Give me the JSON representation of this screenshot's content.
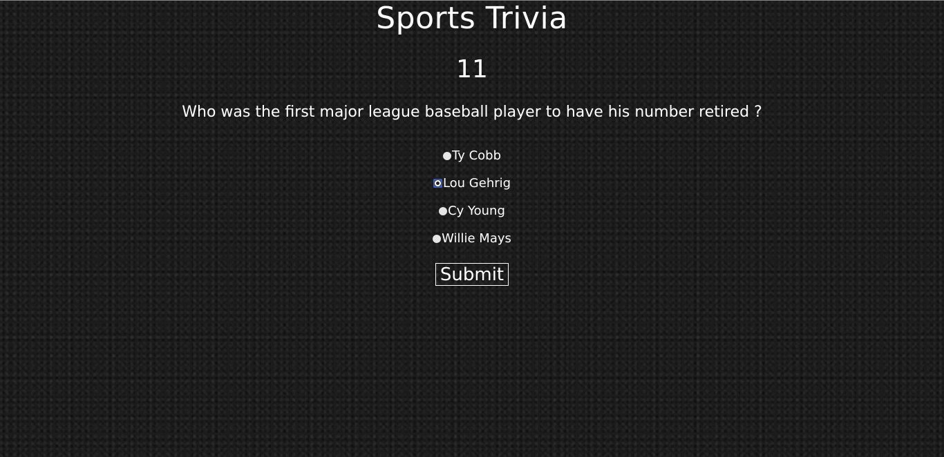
{
  "app": {
    "title": "Sports Trivia"
  },
  "quiz": {
    "question_number": "11",
    "question_text": "Who was the first major league baseball player to have his number retired ?",
    "options": [
      {
        "label": "Ty Cobb",
        "selected": false
      },
      {
        "label": "Lou Gehrig",
        "selected": true
      },
      {
        "label": "Cy Young",
        "selected": false
      },
      {
        "label": "Willie Mays",
        "selected": false
      }
    ],
    "submit_label": "Submit"
  },
  "colors": {
    "background": "#1c1c1c",
    "text": "#ffffff",
    "radio_selected_focus": "#3a5fbf"
  },
  "icons": {
    "option_radio": "radio-button-icon"
  }
}
